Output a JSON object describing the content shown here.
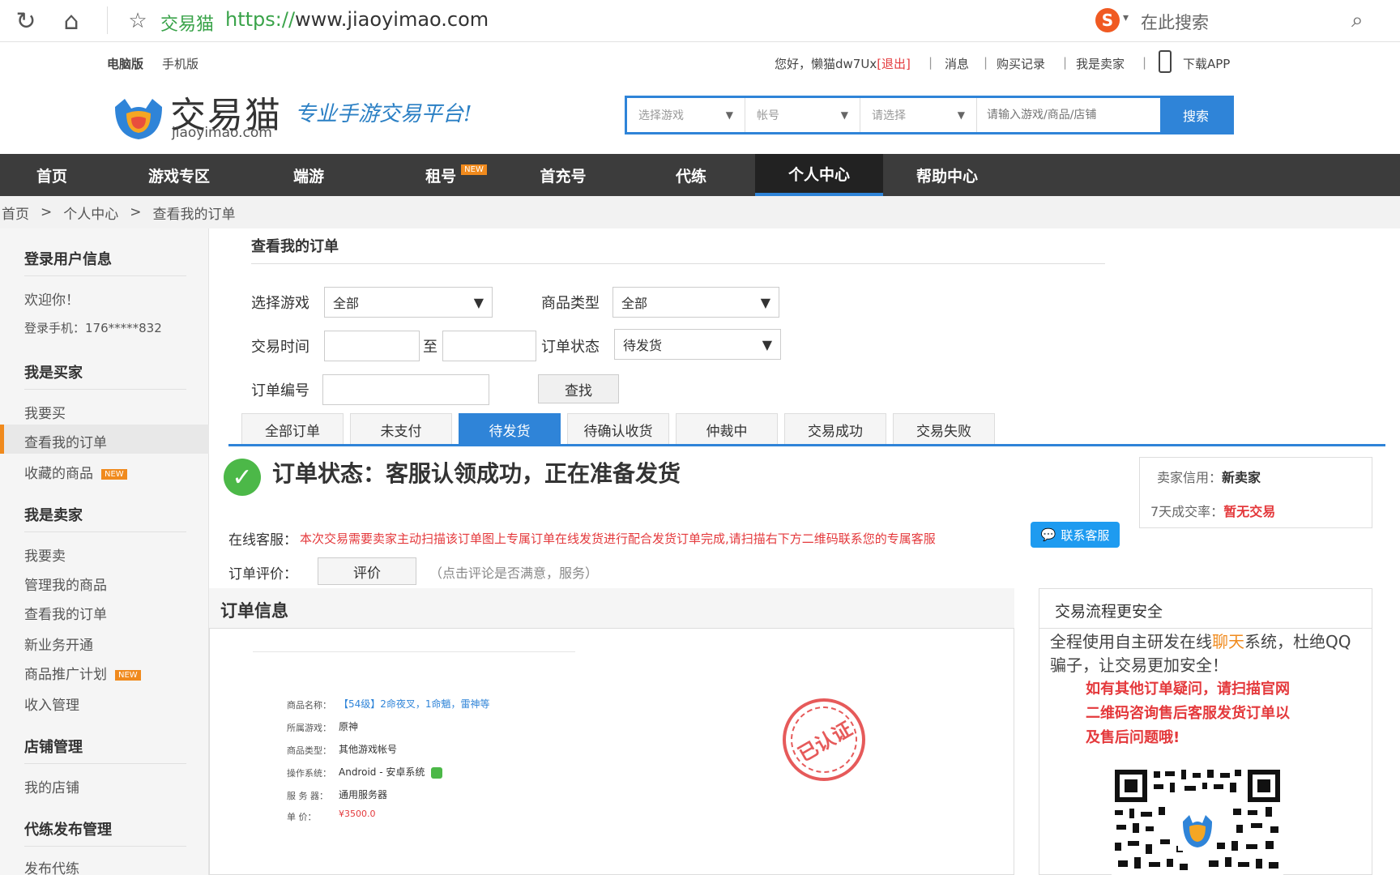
{
  "browser": {
    "site_name": "交易猫",
    "url_proto": "https://",
    "url_rest": "www.jiaoyimao.com",
    "search_placeholder": "在此搜索"
  },
  "topbar": {
    "pc_version": "电脑版",
    "mobile_version": "手机版",
    "greeting": "您好，懒猫dw7Ux",
    "logout": "[退出]",
    "messages": "消息",
    "purchase_records": "购买记录",
    "im_seller": "我是卖家",
    "download_app": "下载APP"
  },
  "logo": {
    "cn": "交易猫",
    "en": "jiaoyimao.com",
    "slogan": "专业手游交易平台!"
  },
  "search": {
    "game_select": "选择游戏",
    "account_select": "帐号",
    "please_select": "请选择",
    "input_placeholder": "请输入游戏/商品/店铺",
    "button": "搜索"
  },
  "nav": {
    "items": [
      "首页",
      "游戏专区",
      "端游",
      "租号",
      "首充号",
      "代练",
      "个人中心",
      "帮助中心"
    ],
    "new_badge": "NEW"
  },
  "breadcrumb": [
    "首页",
    ">",
    "个人中心",
    ">",
    "查看我的订单"
  ],
  "sidebar": {
    "login_info_header": "登录用户信息",
    "welcome": "欢迎你！",
    "phone": "登录手机：176*****832",
    "buyer_header": "我是买家",
    "buy": "我要买",
    "view_orders": "查看我的订单",
    "favorites": "收藏的商品",
    "seller_header": "我是卖家",
    "sell": "我要卖",
    "manage_goods": "管理我的商品",
    "seller_orders": "查看我的订单",
    "new_business": "新业务开通",
    "promo_plan": "商品推广计划",
    "income": "收入管理",
    "shop_header": "店铺管理",
    "my_shop": "我的店铺",
    "boost_header": "代练发布管理",
    "publish_boost": "发布代练",
    "new_badge": "NEW"
  },
  "filters": {
    "page_title": "查看我的订单",
    "game_label": "选择游戏",
    "game_value": "全部",
    "type_label": "商品类型",
    "type_value": "全部",
    "time_label": "交易时间",
    "to": "至",
    "status_label": "订单状态",
    "status_value": "待发货",
    "order_no_label": "订单编号",
    "query_button": "查找"
  },
  "tabs": [
    "全部订单",
    "未支付",
    "待发货",
    "待确认收货",
    "仲裁中",
    "交易成功",
    "交易失败"
  ],
  "status": {
    "text": "订单状态：客服认领成功，正在准备发货",
    "cs_label": "在线客服：",
    "cs_message": "本次交易需要卖家主动扫描该订单图上专属订单在线发货进行配合发货订单完成,请扫描右下方二维码联系您的专属客服",
    "cs_button": "联系客服",
    "eval_label": "订单评价：",
    "eval_button": "评价",
    "eval_hint": "（点击评论是否满意，服务）"
  },
  "seller": {
    "credit_label": "卖家信用：",
    "credit_value": "新卖家",
    "deals_label": "7天成交率：",
    "deals_value": "暂无交易"
  },
  "order_info": {
    "title": "订单信息",
    "rows": [
      {
        "label": "商品名称：",
        "value": "【54级】2命夜叉，1命魈，雷神等"
      },
      {
        "label": "所属游戏：",
        "value": "原神"
      },
      {
        "label": "商品类型：",
        "value": "其他游戏帐号"
      },
      {
        "label": "操作系统：",
        "value": "Android - 安卓系统"
      },
      {
        "label": "服 务 器：",
        "value": "通用服务器"
      },
      {
        "label": "单    价：",
        "value": "¥3500.0"
      }
    ],
    "stamp": "已认证"
  },
  "safety": {
    "title": "交易流程更安全",
    "text_a": "全程使用自主研发在线",
    "text_chat": "聊天",
    "text_b": "系统，杜绝QQ骗子，让交易更加安全！",
    "red_text": "如有其他订单疑问，请扫描官网二维码咨询售后客服发货订单以及售后问题哦!"
  },
  "colors": {
    "accent": "#2f84d8",
    "nav_bg": "#3c3c3c",
    "danger": "#e4393c",
    "new_badge": "#f08a1d",
    "success": "#4cb848"
  }
}
